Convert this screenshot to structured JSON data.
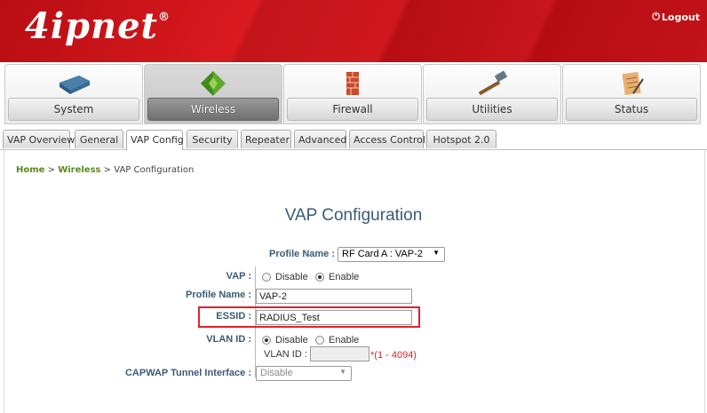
{
  "header": {
    "logo": "4ipnet",
    "logout": "Logout"
  },
  "nav": [
    {
      "label": "System",
      "icon": "router-icon"
    },
    {
      "label": "Wireless",
      "icon": "wireless-diamond-icon"
    },
    {
      "label": "Firewall",
      "icon": "firewall-brick-icon"
    },
    {
      "label": "Utilities",
      "icon": "hammer-icon"
    },
    {
      "label": "Status",
      "icon": "notepad-icon"
    }
  ],
  "tabs": [
    "VAP Overview",
    "General",
    "VAP Config",
    "Security",
    "Repeater",
    "Advanced",
    "Access Control",
    "Hotspot 2.0"
  ],
  "breadcrumb": {
    "home": "Home",
    "sep1": " > ",
    "wireless": "Wireless",
    "sep2": " > VAP Configuration"
  },
  "page_title": "VAP Configuration",
  "profile_select": {
    "label": "Profile Name :",
    "value": "RF Card A : VAP-2"
  },
  "form": {
    "vap": {
      "label": "VAP :",
      "disable": "Disable",
      "enable": "Enable",
      "selected": "Enable"
    },
    "profile_name": {
      "label": "Profile Name :",
      "value": "VAP-2"
    },
    "essid": {
      "label": "ESSID :",
      "value": "RADIUS_Test"
    },
    "vlan": {
      "label": "VLAN ID :",
      "disable": "Disable",
      "enable": "Enable",
      "selected": "Disable",
      "sub_label": "VLAN ID :",
      "value": "",
      "range": "*(1 - 4094)"
    },
    "capwap": {
      "label": "CAPWAP Tunnel Interface :",
      "value": "Disable"
    }
  },
  "colors": {
    "brand_red": "#c8151b",
    "label_blue": "#3b5a78",
    "link_green": "#5a8a1a",
    "highlight": "#e0232a"
  }
}
